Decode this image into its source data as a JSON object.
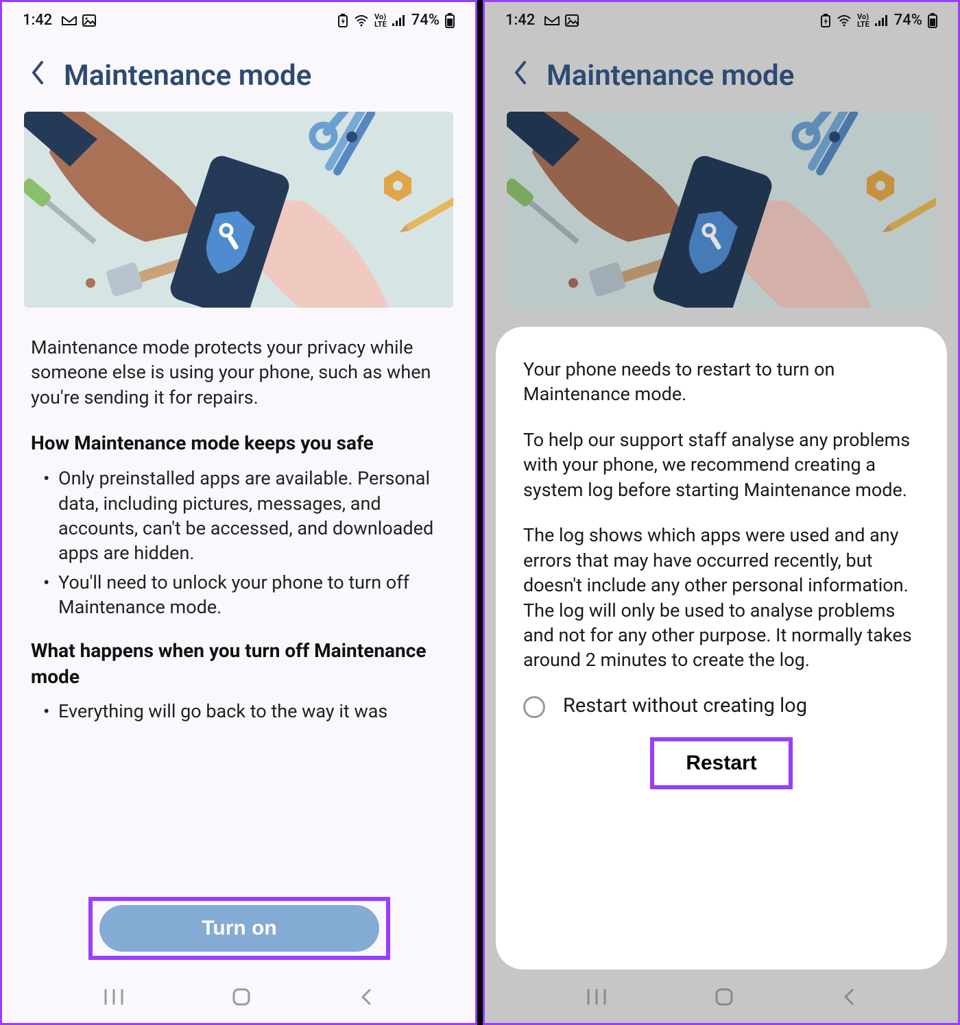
{
  "statusbar": {
    "time": "1:42",
    "battery": "74%"
  },
  "header": {
    "title": "Maintenance mode"
  },
  "left_screen": {
    "intro": "Maintenance mode protects your privacy while someone else is using your phone, such as when you're sending it for repairs.",
    "section1_title": "How Maintenance mode keeps you safe",
    "bullets1": [
      "Only preinstalled apps are available. Personal data, including pictures, messages, and accounts, can't be accessed, and downloaded apps are hidden.",
      "You'll need to unlock your phone to turn off Maintenance mode."
    ],
    "section2_title": "What happens when you turn off Maintenance mode",
    "bullets2": [
      "Everything will go back to the way it was"
    ],
    "button_label": "Turn on"
  },
  "right_screen": {
    "para1": "Your phone needs to restart to turn on Maintenance mode.",
    "para2": "To help our support staff analyse any problems with your phone, we recommend creating a system log before starting Maintenance mode.",
    "para3": "The log shows which apps were used and any errors that may have occurred recently, but doesn't include any other personal information. The log will only be used to analyse problems and not for any other purpose. It normally takes around 2 minutes to create the log.",
    "radio_label": "Restart without creating log",
    "restart_label": "Restart"
  }
}
